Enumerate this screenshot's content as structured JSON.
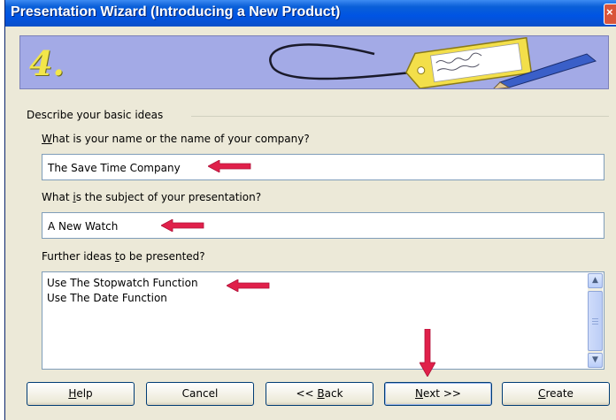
{
  "window": {
    "title": "Presentation Wizard (Introducing a New Product)",
    "close_glyph": "×"
  },
  "banner": {
    "step_number": "4."
  },
  "group": {
    "label": "Describe your basic ideas"
  },
  "fields": {
    "name": {
      "label_prefix": "",
      "label_accel": "W",
      "label_rest": "hat is your name or the name of your company?",
      "value": "The Save Time Company"
    },
    "subject": {
      "label_prefix": "What ",
      "label_accel": "i",
      "label_rest": "s the subject of your presentation?",
      "value": "A New Watch"
    },
    "ideas": {
      "label_prefix": "Further ideas ",
      "label_accel": "t",
      "label_rest": "o be presented?",
      "lines": [
        "Use The Stopwatch Function",
        "Use The Date Function"
      ]
    }
  },
  "buttons": {
    "help": {
      "accel": "H",
      "rest": "elp"
    },
    "cancel": {
      "label": "Cancel"
    },
    "back": {
      "prefix": "<< ",
      "accel": "B",
      "rest": "ack"
    },
    "next": {
      "accel": "N",
      "rest": "ext >>"
    },
    "create": {
      "accel": "C",
      "rest": "reate"
    }
  },
  "colors": {
    "annotation_arrow": "#e0204a",
    "titlebar": "#0054e3",
    "banner": "#a3aae6",
    "step_number": "#f2e64a"
  },
  "icons": [
    "close-icon",
    "scroll-up-icon",
    "scroll-down-icon",
    "tag-illustration",
    "pen-illustration",
    "annotation-arrow-icon"
  ]
}
